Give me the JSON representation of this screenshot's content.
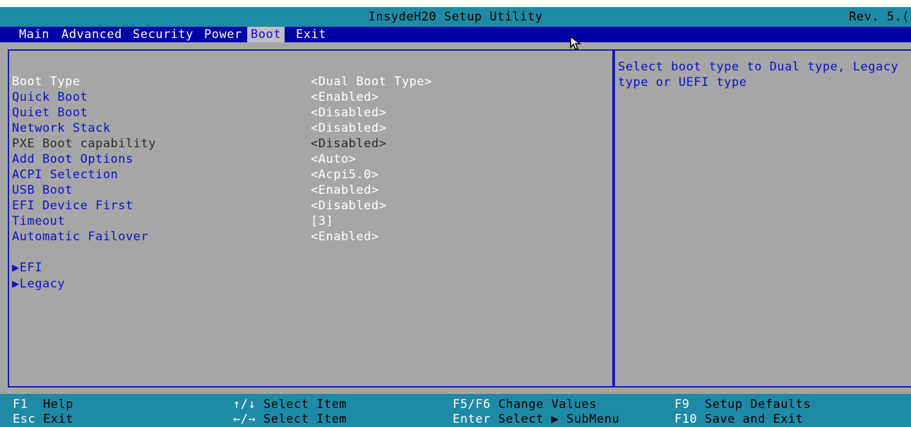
{
  "title": "InsydeH20 Setup Utility",
  "revision": "Rev. 5.(",
  "menu": [
    "Main",
    "Advanced",
    "Security",
    "Power",
    "Boot",
    "Exit"
  ],
  "active_menu": "Boot",
  "settings": [
    {
      "label": "Boot Type",
      "value": "<Dual Boot Type>"
    },
    {
      "label": "Quick Boot",
      "value": "<Enabled>"
    },
    {
      "label": "Quiet Boot",
      "value": "<Disabled>"
    },
    {
      "label": "Network Stack",
      "value": "<Disabled>"
    },
    {
      "label": "PXE Boot capability",
      "value": "<Disabled>"
    },
    {
      "label": "Add Boot Options",
      "value": "<Auto>"
    },
    {
      "label": "ACPI Selection",
      "value": "<Acpi5.0>"
    },
    {
      "label": "USB Boot",
      "value": "<Enabled>"
    },
    {
      "label": "EFI Device First",
      "value": "<Disabled>"
    },
    {
      "label": "Timeout",
      "value": "[3]"
    },
    {
      "label": "Automatic Failover",
      "value": "<Enabled>"
    }
  ],
  "submenus": [
    "▶EFI",
    "▶Legacy"
  ],
  "help_text": [
    "Select boot type to Dual type, Legacy",
    "type or UEFI type"
  ],
  "footer": [
    {
      "key": "F1",
      "desc": "Help"
    },
    {
      "key": "Esc",
      "desc": "Exit"
    },
    {
      "key": "↑/↓",
      "desc": "Select Item"
    },
    {
      "key": "←/→",
      "desc": "Select Item"
    },
    {
      "key": "F5/F6",
      "desc": "Change Values"
    },
    {
      "key": "Enter",
      "desc": "Select ▶ SubMenu"
    },
    {
      "key": "F9",
      "desc": "Setup Defaults"
    },
    {
      "key": "F10",
      "desc": "Save and Exit"
    }
  ],
  "icons": {
    "cursor": "mouse-pointer-icon"
  },
  "colors": {
    "menubar": "#0000a8",
    "header": "#1f8aa4",
    "panel": "#a6a6a6",
    "highlight": "#ffffff",
    "label": "#1010c8"
  }
}
